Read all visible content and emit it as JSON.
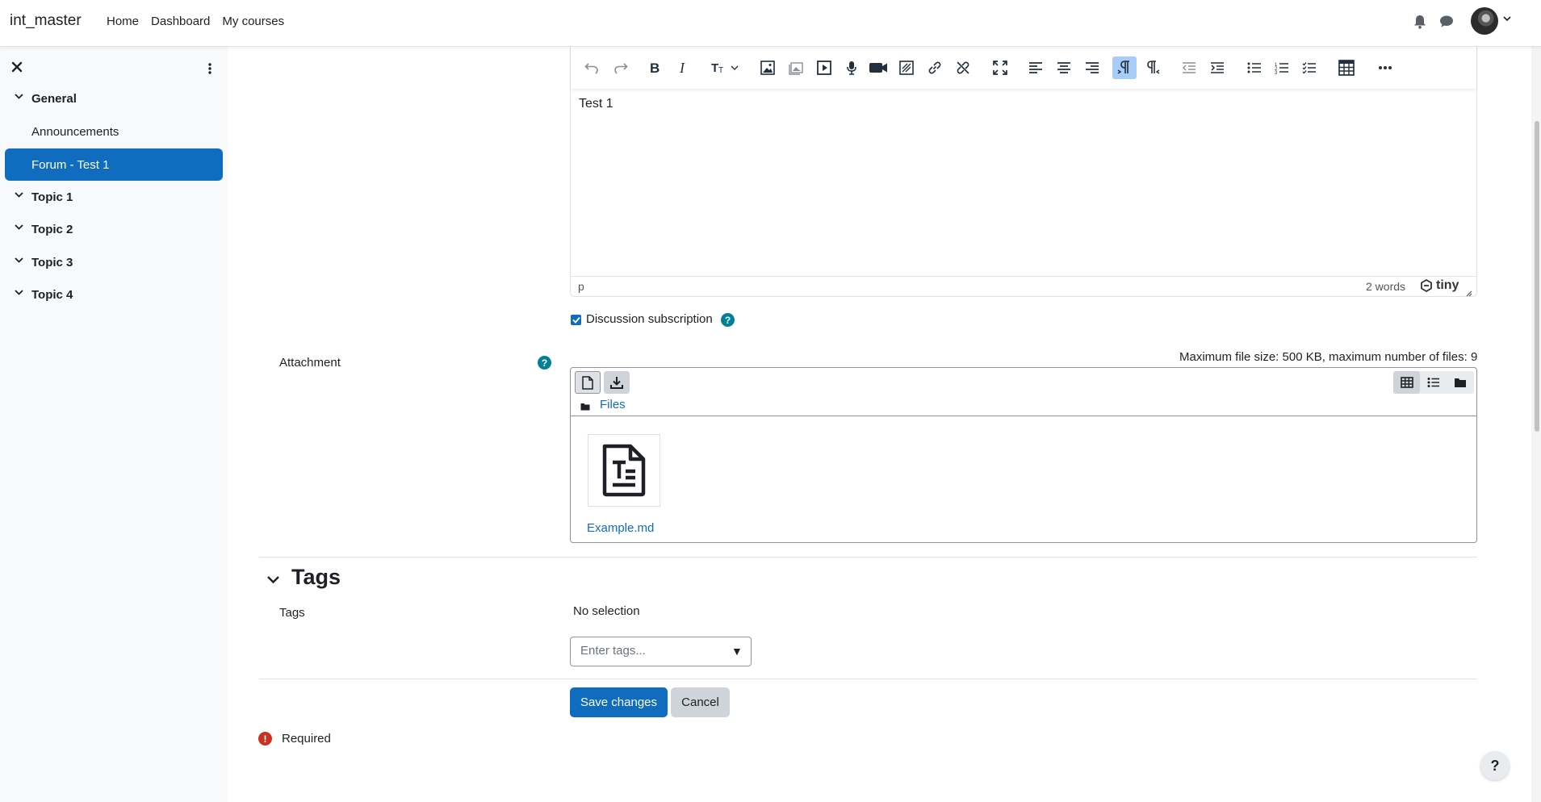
{
  "navbar": {
    "brand": "int_master",
    "links": [
      "Home",
      "Dashboard",
      "My courses"
    ]
  },
  "sidebar": {
    "items": [
      {
        "label": "General",
        "type": "section"
      },
      {
        "label": "Announcements",
        "type": "activity"
      },
      {
        "label": "Forum - Test 1",
        "type": "activity",
        "active": true
      },
      {
        "label": "Topic 1",
        "type": "section"
      },
      {
        "label": "Topic 2",
        "type": "section"
      },
      {
        "label": "Topic 3",
        "type": "section"
      },
      {
        "label": "Topic 4",
        "type": "section"
      }
    ]
  },
  "editor": {
    "content": "Test 1",
    "path": "p",
    "word_count": "2 words",
    "brand": "tiny"
  },
  "subscription": {
    "label": "Discussion subscription",
    "checked": true
  },
  "attachment": {
    "label": "Attachment",
    "max_size_text": "Maximum file size: 500 KB, maximum number of files: 9",
    "path_label": "Files",
    "files": [
      {
        "name": "Example.md"
      }
    ]
  },
  "tags": {
    "heading": "Tags",
    "label": "Tags",
    "selection": "No selection",
    "placeholder": "Enter tags..."
  },
  "buttons": {
    "save": "Save changes",
    "cancel": "Cancel"
  },
  "required": {
    "text": "Required"
  },
  "help_fab": "?",
  "colors": {
    "primary": "#0f6cbf",
    "help": "#008196",
    "required": "#ca3120",
    "sidebar_bg": "#f8f9fa"
  }
}
